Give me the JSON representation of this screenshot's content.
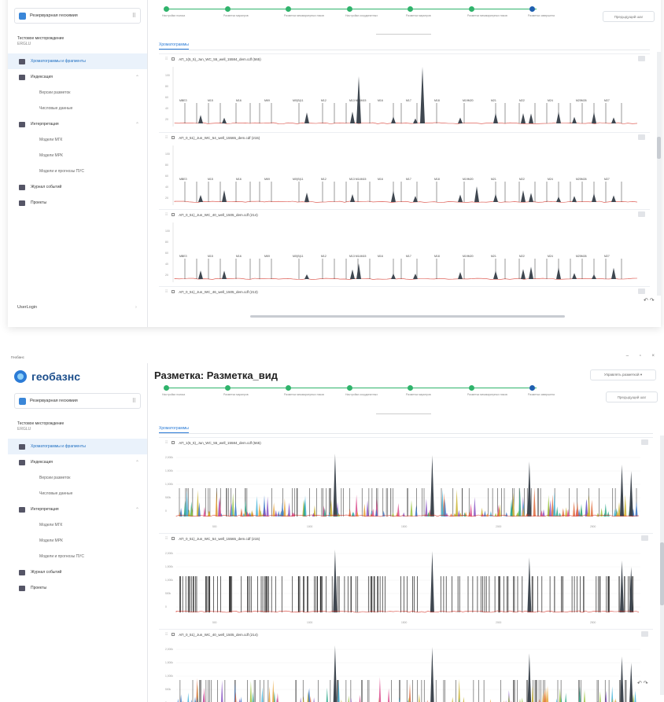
{
  "app": {
    "window_title": "Геобанс",
    "window_controls": "– ▫ ×",
    "logo_text": "геобазнс",
    "reservoir": "Резервуарная геохимия",
    "reservoir_switch_icon": "grid-switch-icon",
    "field_name": "Тестовое месторождение",
    "field_sub": "ERGLU"
  },
  "sidebar": {
    "items": [
      {
        "label": "Хроматограммы и фрагменты",
        "icon": "chromatogram-icon",
        "active": true
      },
      {
        "label": "Индексация",
        "icon": "chart-icon",
        "chevron": "⌃"
      },
      {
        "label": "Версии разметок",
        "sub": true
      },
      {
        "label": "Числовые данные",
        "sub": true
      },
      {
        "label": "Интерпретация",
        "icon": "list-icon",
        "chevron": "⌃"
      },
      {
        "label": "Модели МГК",
        "sub": true
      },
      {
        "label": "Модели МРК",
        "sub": true
      },
      {
        "label": "Модели и прогнозы ПУС",
        "sub": true
      },
      {
        "label": "Журнал событий",
        "icon": "journal-icon"
      },
      {
        "label": "Проекты",
        "icon": "projects-icon"
      }
    ],
    "user": "UserLogin",
    "user_chevron": "›"
  },
  "header": {
    "title": "Разметка: Разметка_вид",
    "manage_button": "Управлять разметкой ▾",
    "prev_button": "Предыдущий шаг"
  },
  "steps": [
    "Настройки поиска",
    "Разметка маркеров",
    "Разметка межмаркерных пиков",
    "Настройки координатных",
    "Разметка маркеров",
    "Разметка межмаркерных пиков",
    "Разметка завершена"
  ],
  "tab": "Хроматограммы",
  "panels": [
    {
      "file": "АП_1(5_5)_Jun_WC_55_well_15584_dem.cdf (565)"
    },
    {
      "file": "АП_0_51)_Jun_WC_54_well_15565_dem.cdf (215)"
    },
    {
      "file": "АП_0_51)_Jun_WC_40_well_1505_dem.cdf (214)"
    },
    {
      "file": "АП_0_51)_Jun_WC_46_well_1505_dem.cdf (213)"
    }
  ],
  "peak_labels_top": [
    "МВЕЗ",
    "М15",
    "М16",
    "МК9",
    "МЛ(В)11",
    "М12",
    "М13 М14М15",
    "М16",
    "М17",
    "М18",
    "М19М20",
    "М21",
    "М22",
    "М24",
    "М25М26",
    "М27"
  ],
  "y_ticks_top": [
    "20",
    "40",
    "60",
    "80",
    "100"
  ],
  "y_ticks_bottom": [
    "2,000k",
    "1,500k",
    "1,000k",
    "500k",
    "0"
  ],
  "x_ticks_bottom": [
    "500",
    "1000",
    "1500",
    "2000",
    "2500"
  ],
  "undo_redo": "↶ ↷"
}
